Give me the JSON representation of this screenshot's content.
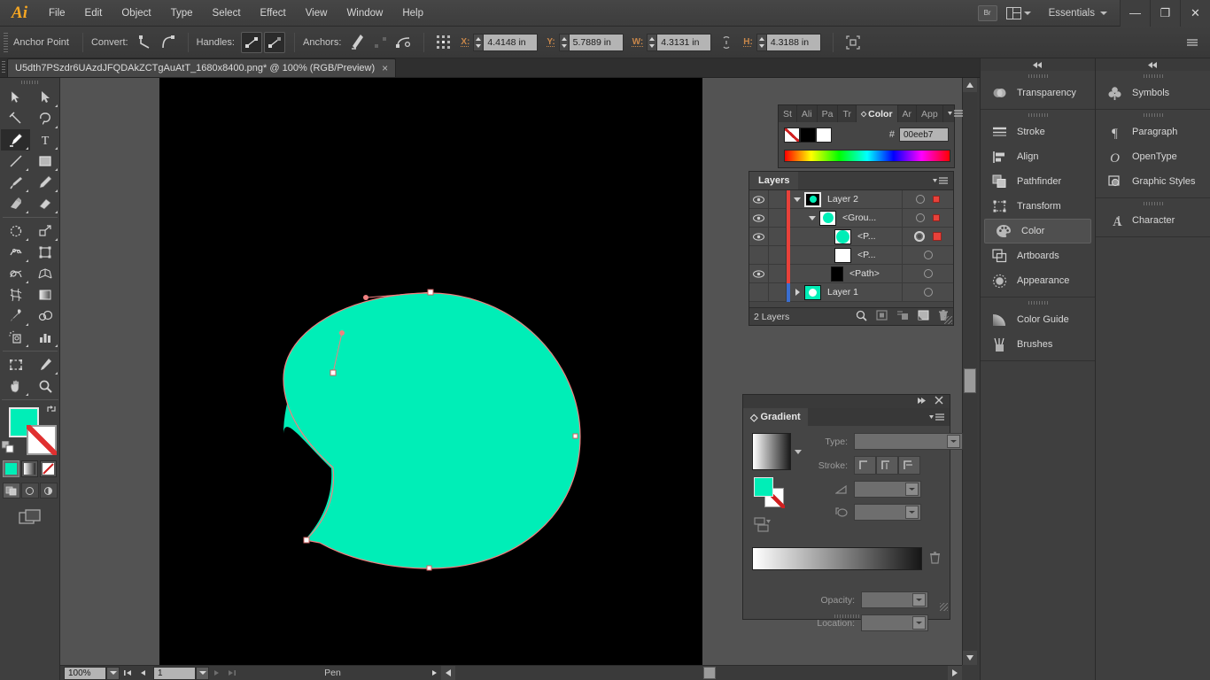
{
  "app": {
    "name": "Ai",
    "workspace": "Essentials",
    "bridge_label": "Br"
  },
  "menubar": {
    "items": [
      "File",
      "Edit",
      "Object",
      "Type",
      "Select",
      "Effect",
      "View",
      "Window",
      "Help"
    ]
  },
  "window_controls": {
    "minimize": "—",
    "maximize": "❐",
    "close": "✕"
  },
  "control_bar": {
    "tool_label": "Anchor Point",
    "convert_label": "Convert:",
    "handles_label": "Handles:",
    "anchors_label": "Anchors:",
    "fields": [
      {
        "label": "X:",
        "value": "4.4148 in"
      },
      {
        "label": "Y:",
        "value": "5.7889 in"
      },
      {
        "label": "W:",
        "value": "4.3131 in"
      },
      {
        "label": "H:",
        "value": "4.3188 in"
      }
    ]
  },
  "document": {
    "tab_title": "U5dth7PSzdr6UAzdJFQDAkZCTgAuAtT_1680x8400.png* @ 100% (RGB/Preview)",
    "close_glyph": "×"
  },
  "canvas": {
    "background": "#000000",
    "shape_color": "#00eeb7",
    "path_color": "#f08080"
  },
  "status_bar": {
    "zoom": "100%",
    "page": "1",
    "tool": "Pen"
  },
  "color_panel": {
    "tabs": [
      "St",
      "Ali",
      "Pa",
      "Tr",
      "Color",
      "Ar",
      "App"
    ],
    "active_tab": "Color",
    "hex_symbol": "#",
    "hex_value": "00eeb7",
    "swatch_none": "none-swatch",
    "swatch_black": "#000000",
    "swatch_white": "#ffffff"
  },
  "layers_panel": {
    "title": "Layers",
    "footer_count": "2 Layers",
    "rows": [
      {
        "name": "Layer 2",
        "indent": 0,
        "eye": true,
        "arrow": "down",
        "thumb": "#000000",
        "thumb_dot": "#00eeb7",
        "target": "single",
        "selected": true,
        "sel_size": "small",
        "color": "#e8413a"
      },
      {
        "name": "<Grou...",
        "indent": 1,
        "eye": true,
        "arrow": "down",
        "thumb": "#ffffff",
        "thumb_dot": "#00eeb7",
        "target": "single",
        "selected": true,
        "sel_size": "small",
        "color": "#e8413a"
      },
      {
        "name": "<P...",
        "indent": 2,
        "eye": true,
        "arrow": "none",
        "thumb": "#ffffff",
        "thumb_dot": "#00eeb7",
        "target": "double",
        "selected": true,
        "sel_size": "big",
        "color": "#e8413a"
      },
      {
        "name": "<P...",
        "indent": 2,
        "eye": false,
        "arrow": "none",
        "thumb": "#ffffff",
        "thumb_dot": "",
        "target": "single",
        "selected": false,
        "sel_size": "small",
        "color": "#e8413a"
      },
      {
        "name": "<Path>",
        "indent": 2,
        "eye": true,
        "arrow": "none",
        "thumb": "#000000",
        "thumb_dot": "",
        "target": "single",
        "selected": false,
        "sel_size": "small",
        "color": "#e8413a"
      },
      {
        "name": "Layer 1",
        "indent": 0,
        "eye": false,
        "arrow": "right",
        "thumb": "#00eeb7",
        "thumb_dot": "#ffffff",
        "target": "single",
        "selected": false,
        "sel_size": "small",
        "color": "#3a6ed0"
      }
    ],
    "footer_icons": [
      "locate-object-icon",
      "make-mask-icon",
      "new-sublayer-icon",
      "new-layer-icon",
      "delete-layer-icon"
    ]
  },
  "gradient_panel": {
    "title": "Gradient",
    "type_label": "Type:",
    "type_value": "",
    "stroke_label": "Stroke:",
    "angle_value": "",
    "aspect_value": "",
    "opacity_label": "Opacity:",
    "opacity_value": "",
    "location_label": "Location:",
    "location_value": "",
    "fill_color": "#00eeb7"
  },
  "dock_left": {
    "groups": [
      {
        "items": [
          {
            "label": "Transparency",
            "icon": "transparency-icon"
          }
        ]
      },
      {
        "items": [
          {
            "label": "Stroke",
            "icon": "stroke-icon"
          },
          {
            "label": "Align",
            "icon": "align-icon"
          },
          {
            "label": "Pathfinder",
            "icon": "pathfinder-icon"
          },
          {
            "label": "Transform",
            "icon": "transform-icon"
          },
          {
            "label": "Color",
            "icon": "color-icon",
            "active": true
          },
          {
            "label": "Artboards",
            "icon": "artboards-icon"
          },
          {
            "label": "Appearance",
            "icon": "appearance-icon"
          }
        ]
      },
      {
        "items": [
          {
            "label": "Color Guide",
            "icon": "color-guide-icon"
          },
          {
            "label": "Brushes",
            "icon": "brushes-icon"
          }
        ]
      }
    ]
  },
  "dock_right": {
    "groups": [
      {
        "items": [
          {
            "label": "Symbols",
            "icon": "symbols-icon"
          }
        ]
      },
      {
        "items": [
          {
            "label": "Paragraph",
            "icon": "paragraph-icon"
          },
          {
            "label": "OpenType",
            "icon": "opentype-icon"
          },
          {
            "label": "Graphic Styles",
            "icon": "graphic-styles-icon"
          }
        ]
      },
      {
        "items": [
          {
            "label": "Character",
            "icon": "character-icon"
          }
        ]
      }
    ]
  },
  "toolbar": {
    "tools": [
      "selection-tool",
      "direct-selection-tool",
      "magic-wand-tool",
      "lasso-tool",
      "pen-tool",
      "type-tool",
      "line-segment-tool",
      "rectangle-tool",
      "paintbrush-tool",
      "pencil-tool",
      "blob-brush-tool",
      "eraser-tool",
      "rotate-tool",
      "scale-tool",
      "width-tool",
      "free-transform-tool",
      "shape-builder-tool",
      "perspective-grid-tool",
      "mesh-tool",
      "gradient-tool",
      "eyedropper-tool",
      "blend-tool",
      "symbol-sprayer-tool",
      "column-graph-tool",
      "artboard-tool",
      "slice-tool",
      "hand-tool",
      "zoom-tool"
    ],
    "active_tool": "pen-tool",
    "fill_color": "#00eeb7",
    "stroke_color": "none"
  }
}
